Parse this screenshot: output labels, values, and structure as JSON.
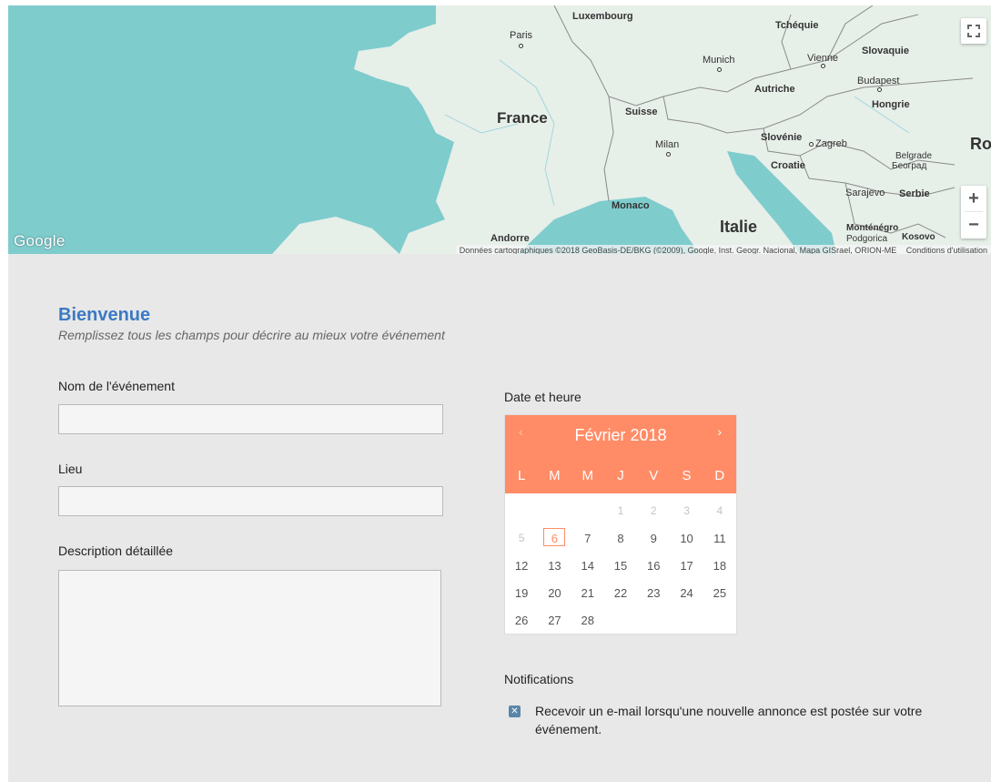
{
  "map": {
    "google_logo": "Google",
    "attribution": "Données cartographiques ©2018 GeoBasis-DE/BKG (©2009), Google, Inst. Geogr. Nacional, Mapa GISrael, ORION-ME",
    "terms": "Conditions d'utilisation",
    "zoom_in": "+",
    "zoom_out": "−",
    "labels": {
      "luxembourg": "Luxembourg",
      "paris": "Paris",
      "france": "France",
      "suisse": "Suisse",
      "milan": "Milan",
      "monaco": "Monaco",
      "andorre": "Andorre",
      "italie": "Italie",
      "munich": "Munich",
      "tchequie": "Tchéquie",
      "vienne": "Vienne",
      "autriche": "Autriche",
      "slovaquie": "Slovaquie",
      "budapest": "Budapest",
      "hongrie": "Hongrie",
      "slovenie": "Slovénie",
      "zagreb": "Zagreb",
      "croatie": "Croatie",
      "belgrade": "Belgrade",
      "beograd": "Београд",
      "ro": "Ro",
      "sarajevo": "Sarajevo",
      "serbie": "Serbie",
      "montenegro": "Monténégro",
      "podgorica": "Podgorica",
      "kosovo": "Kosovo"
    }
  },
  "welcome": {
    "title": "Bienvenue",
    "subtitle": "Remplissez tous les champs pour décrire au mieux votre événement"
  },
  "form": {
    "event_name_label": "Nom de l'événement",
    "event_name_value": "",
    "place_label": "Lieu",
    "place_value": "",
    "description_label": "Description détaillée",
    "description_value": "",
    "date_label": "Date et heure"
  },
  "calendar": {
    "prev": "‹",
    "next": "›",
    "month_title": "Février 2018",
    "weekdays": [
      "L",
      "M",
      "M",
      "J",
      "V",
      "S",
      "D"
    ],
    "weeks": [
      [
        {
          "d": "",
          "m": false
        },
        {
          "d": "",
          "m": false
        },
        {
          "d": "",
          "m": false
        },
        {
          "d": "1",
          "m": true
        },
        {
          "d": "2",
          "m": true
        },
        {
          "d": "3",
          "m": true
        },
        {
          "d": "4",
          "m": true
        }
      ],
      [
        {
          "d": "5",
          "m": true
        },
        {
          "d": "6",
          "m": false,
          "today": true
        },
        {
          "d": "7",
          "m": false
        },
        {
          "d": "8",
          "m": false
        },
        {
          "d": "9",
          "m": false
        },
        {
          "d": "10",
          "m": false
        },
        {
          "d": "11",
          "m": false
        }
      ],
      [
        {
          "d": "12",
          "m": false
        },
        {
          "d": "13",
          "m": false
        },
        {
          "d": "14",
          "m": false
        },
        {
          "d": "15",
          "m": false
        },
        {
          "d": "16",
          "m": false
        },
        {
          "d": "17",
          "m": false
        },
        {
          "d": "18",
          "m": false
        }
      ],
      [
        {
          "d": "19",
          "m": false
        },
        {
          "d": "20",
          "m": false
        },
        {
          "d": "21",
          "m": false
        },
        {
          "d": "22",
          "m": false
        },
        {
          "d": "23",
          "m": false
        },
        {
          "d": "24",
          "m": false
        },
        {
          "d": "25",
          "m": false
        }
      ],
      [
        {
          "d": "26",
          "m": false
        },
        {
          "d": "27",
          "m": false
        },
        {
          "d": "28",
          "m": false
        },
        {
          "d": "",
          "m": false
        },
        {
          "d": "",
          "m": false
        },
        {
          "d": "",
          "m": false
        },
        {
          "d": "",
          "m": false
        }
      ]
    ]
  },
  "notifications": {
    "title": "Notifications",
    "checkbox_mark": "✕",
    "email_option": "Recevoir un e-mail lorsqu'une nouvelle annonce est postée sur votre événement."
  },
  "colors": {
    "accent": "#ff8c66",
    "title_blue": "#3b7ac4",
    "checkbox": "#5b86a8"
  }
}
